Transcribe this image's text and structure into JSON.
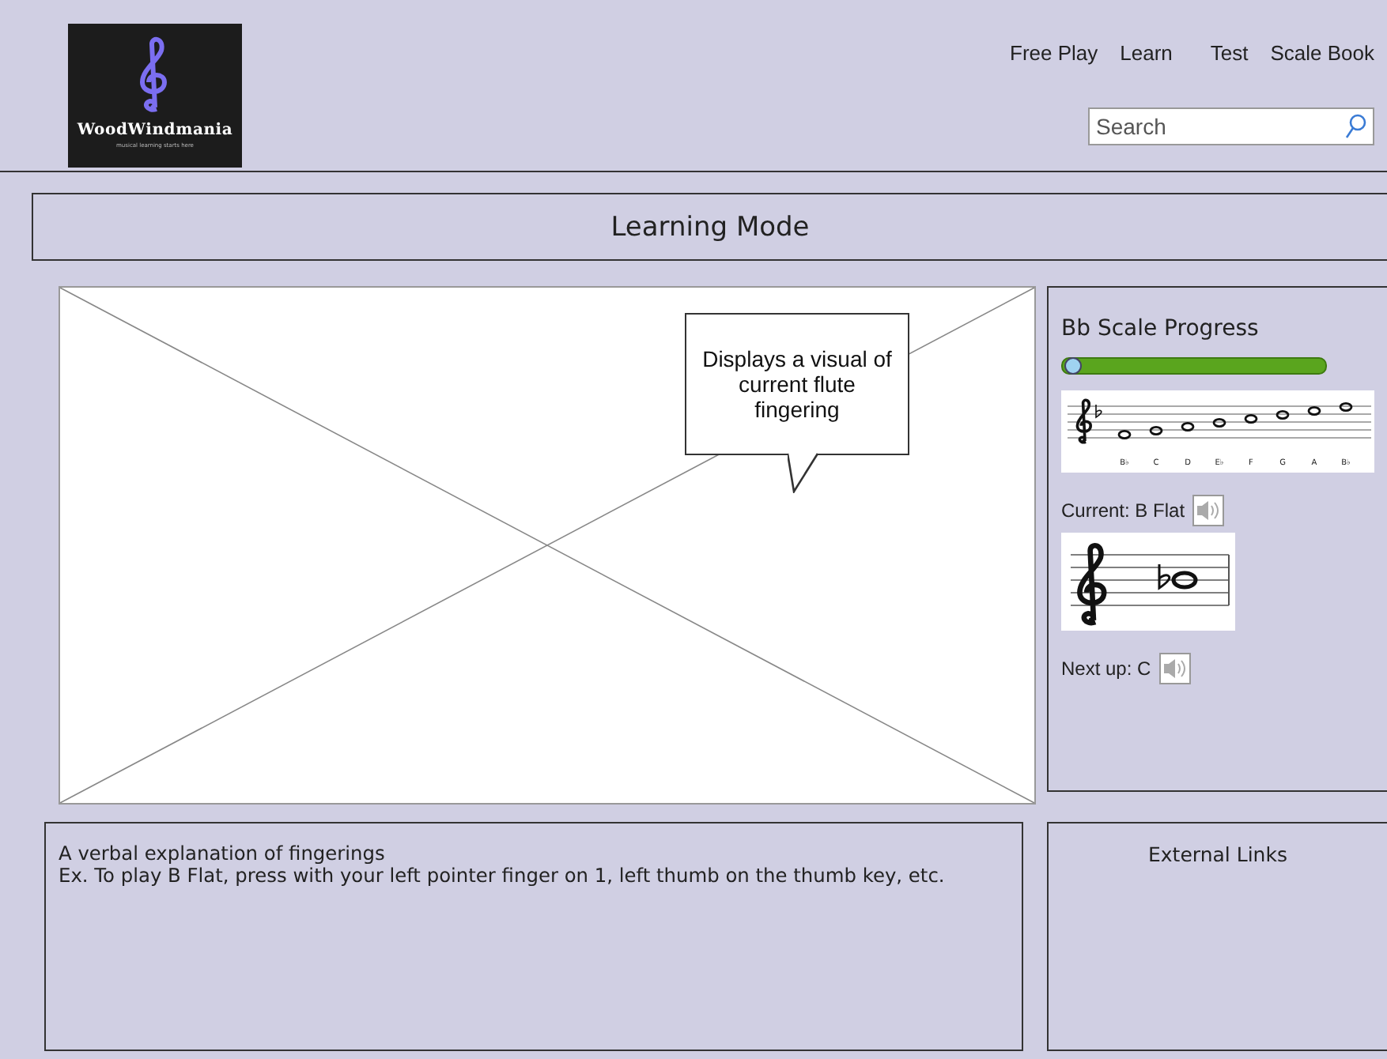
{
  "logo": {
    "name": "WoodWindmania",
    "tagline": "musical learning starts here"
  },
  "nav": [
    {
      "label": "Free Play"
    },
    {
      "label": "Learn"
    },
    {
      "label": "Test"
    },
    {
      "label": "Scale Book"
    }
  ],
  "search": {
    "placeholder": "Search"
  },
  "page_title": "Learning Mode",
  "callout": "Displays a visual of current flute fingering",
  "progress": {
    "title": "Bb Scale Progress",
    "level": 0.02,
    "scale_notes": [
      "B♭",
      "C",
      "D",
      "E♭",
      "F",
      "G",
      "A",
      "B♭"
    ]
  },
  "current": {
    "label": "Current: B Flat"
  },
  "next": {
    "label": "Next up: C"
  },
  "explanation": [
    "A verbal explanation of fingerings",
    "Ex. To play B Flat, press with your left pointer finger on 1, left thumb on the thumb key, etc."
  ],
  "links": {
    "title": "External Links"
  }
}
